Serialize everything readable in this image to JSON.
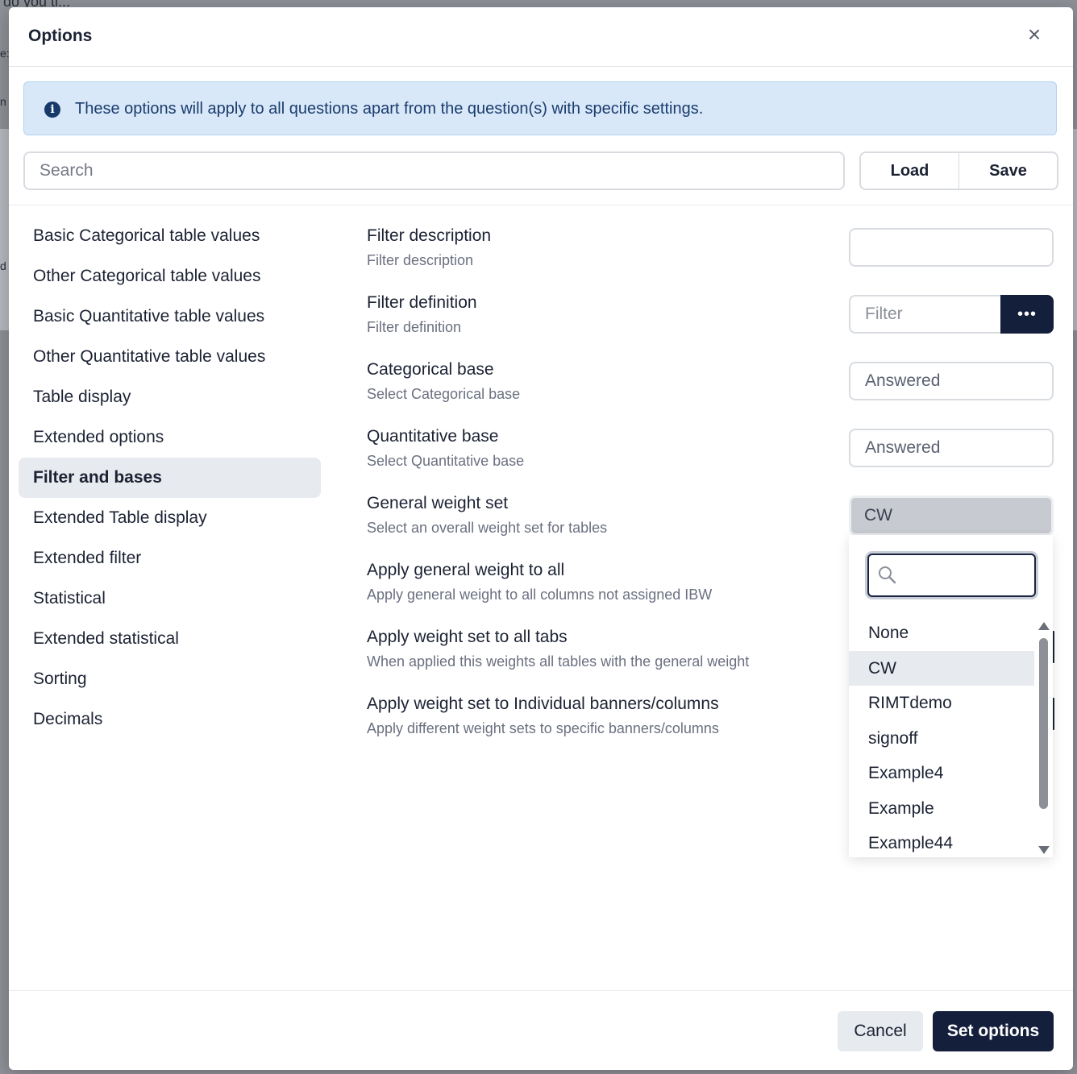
{
  "background": {
    "fragment_top": "do you ti...",
    "fragment_left_1": "e:",
    "fragment_left_2": "n",
    "fragment_left_3": "d"
  },
  "modal": {
    "title": "Options",
    "close_label": "×",
    "info": {
      "icon": "info-icon",
      "text": "These options will apply to all questions apart from the question(s) with specific settings."
    },
    "search": {
      "placeholder": "Search",
      "value": ""
    },
    "load_label": "Load",
    "save_label": "Save"
  },
  "sidebar": {
    "items": [
      {
        "label": "Basic Categorical table values"
      },
      {
        "label": "Other Categorical table values"
      },
      {
        "label": "Basic Quantitative table values"
      },
      {
        "label": "Other Quantitative table values"
      },
      {
        "label": "Table display"
      },
      {
        "label": "Extended options"
      },
      {
        "label": "Filter and bases"
      },
      {
        "label": "Extended Table display"
      },
      {
        "label": "Extended filter"
      },
      {
        "label": "Statistical"
      },
      {
        "label": "Extended statistical"
      },
      {
        "label": "Sorting"
      },
      {
        "label": "Decimals"
      }
    ],
    "active": "Filter and bases"
  },
  "settings": {
    "rows": [
      {
        "label": "Filter description",
        "sub": "Filter description",
        "value": ""
      },
      {
        "label": "Filter definition",
        "sub": "Filter definition",
        "placeholder": "Filter",
        "button": "•••"
      },
      {
        "label": "Categorical base",
        "sub": "Select Categorical base",
        "value": "Answered"
      },
      {
        "label": "Quantitative base",
        "sub": "Select Quantitative base",
        "value": "Answered"
      },
      {
        "label": "General weight set",
        "sub": "Select an overall weight set for tables",
        "value": "CW"
      },
      {
        "label": "Apply general weight to all",
        "sub": "Apply general weight to all columns not assigned IBW"
      },
      {
        "label": "Apply weight set to all tabs",
        "sub": "When applied this weights all tables with the general weight"
      },
      {
        "label": "Apply weight set to Individual banners/columns",
        "sub": "Apply different weight sets to specific banners/columns"
      }
    ]
  },
  "dropdown": {
    "search_value": "",
    "options": [
      "None",
      "CW",
      "RIMTdemo",
      "signoff",
      "Example4",
      "Example",
      "Example44"
    ],
    "selected": "CW"
  },
  "footer": {
    "cancel_label": "Cancel",
    "set_label": "Set options"
  },
  "colors": {
    "primary": "#141f3b",
    "info_bg": "#d8e8f8",
    "info_text": "#1a3c6e",
    "active_bg": "#e7eaee"
  }
}
